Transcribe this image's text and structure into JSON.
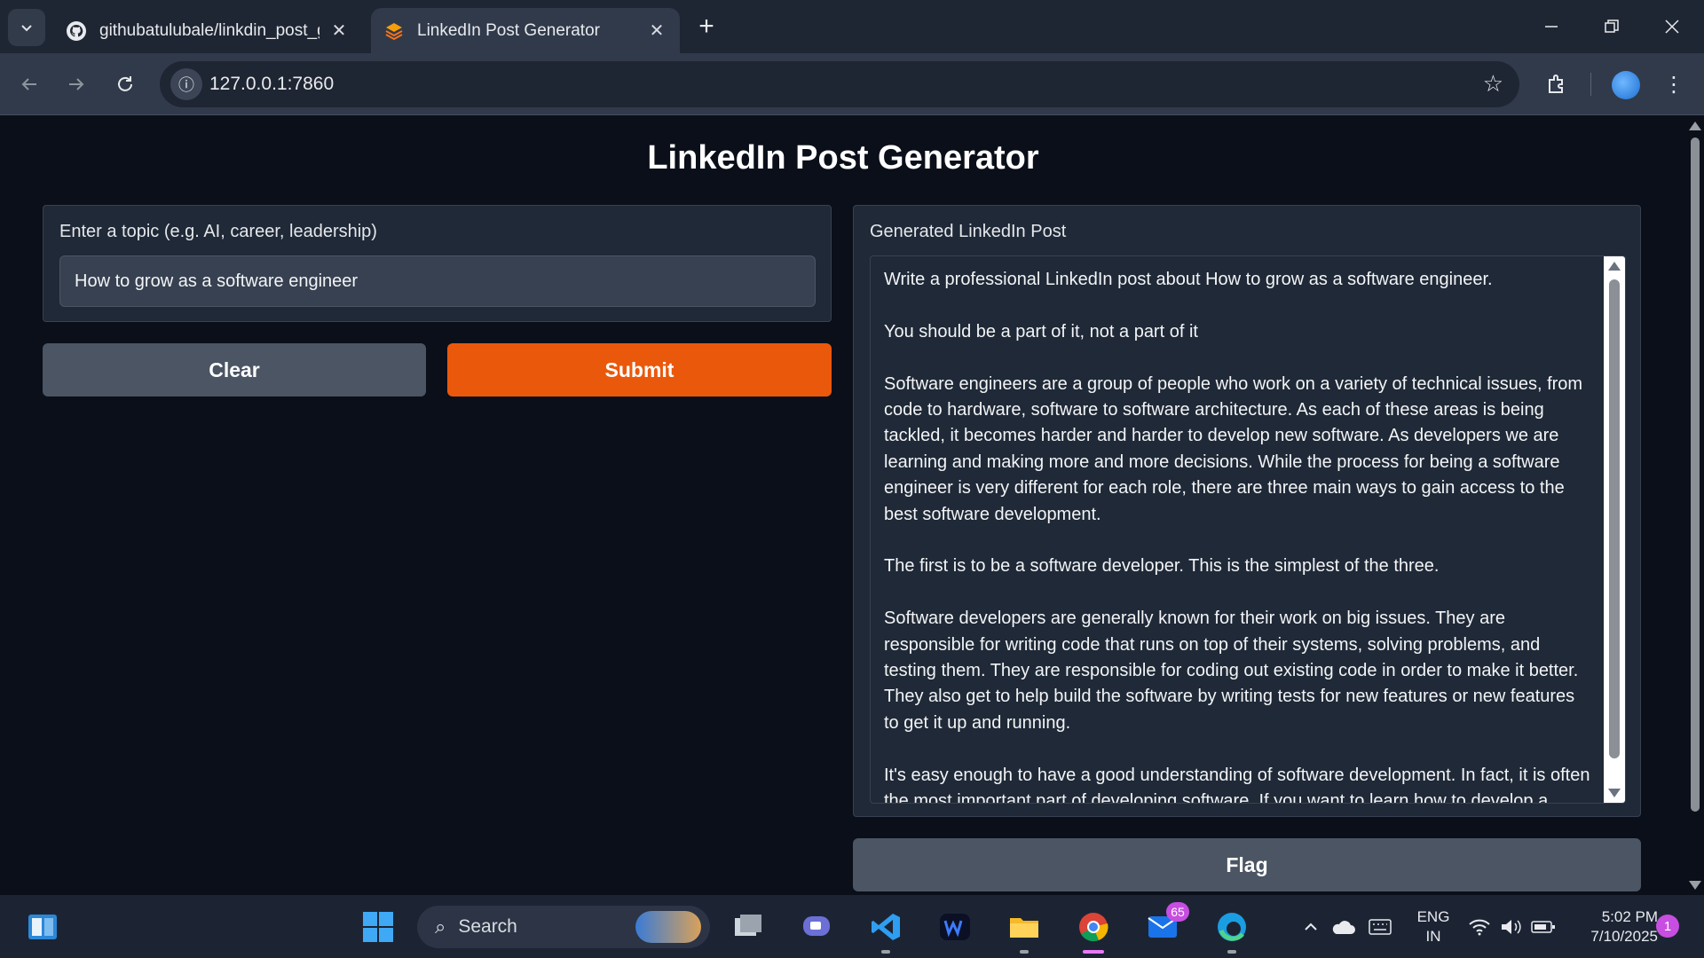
{
  "browser": {
    "tabs": [
      {
        "title": "githubatulubale/linkdin_post_g",
        "favicon": "github-icon",
        "active": false
      },
      {
        "title": "LinkedIn Post Generator",
        "favicon": "gradio-icon",
        "active": true
      }
    ],
    "url": "127.0.0.1:7860"
  },
  "page": {
    "title": "LinkedIn Post Generator",
    "input": {
      "label": "Enter a topic (e.g. AI, career, leadership)",
      "value": "How to grow as a software engineer"
    },
    "buttons": {
      "clear": "Clear",
      "submit": "Submit",
      "flag": "Flag"
    },
    "output": {
      "label": "Generated LinkedIn Post",
      "paragraphs": [
        "Write a professional LinkedIn post about How to grow as a software engineer.",
        "You should be a part of it, not a part of it",
        "Software engineers are a group of people who work on a variety of technical issues, from code to hardware, software to software architecture. As each of these areas is being tackled, it becomes harder and harder to develop new software. As developers we are learning and making more and more decisions. While the process for being a software engineer is very different for each role, there are three main ways to gain access to the best software development.",
        "The first is to be a software developer. This is the simplest of the three.",
        "Software developers are generally known for their work on big issues. They are responsible for writing code that runs on top of their systems, solving problems, and testing them. They are responsible for coding out existing code in order to make it better. They also get to help build the software by writing tests for new features or new features to get it up and running.",
        "It's easy enough to have a good understanding of software development. In fact, it is often the most important part of developing software. If you want to learn how to develop a software product, you need to know how to build, test, debug, and test it. If you already"
      ]
    }
  },
  "taskbar": {
    "search_label": "Search",
    "mail_badge": "65",
    "language": "ENG",
    "region": "IN",
    "time": "5:02 PM",
    "date": "7/10/2025",
    "notifications": "1"
  },
  "colors": {
    "accent": "#ea580c",
    "panel": "#1f2937",
    "background": "#0b0f19"
  }
}
